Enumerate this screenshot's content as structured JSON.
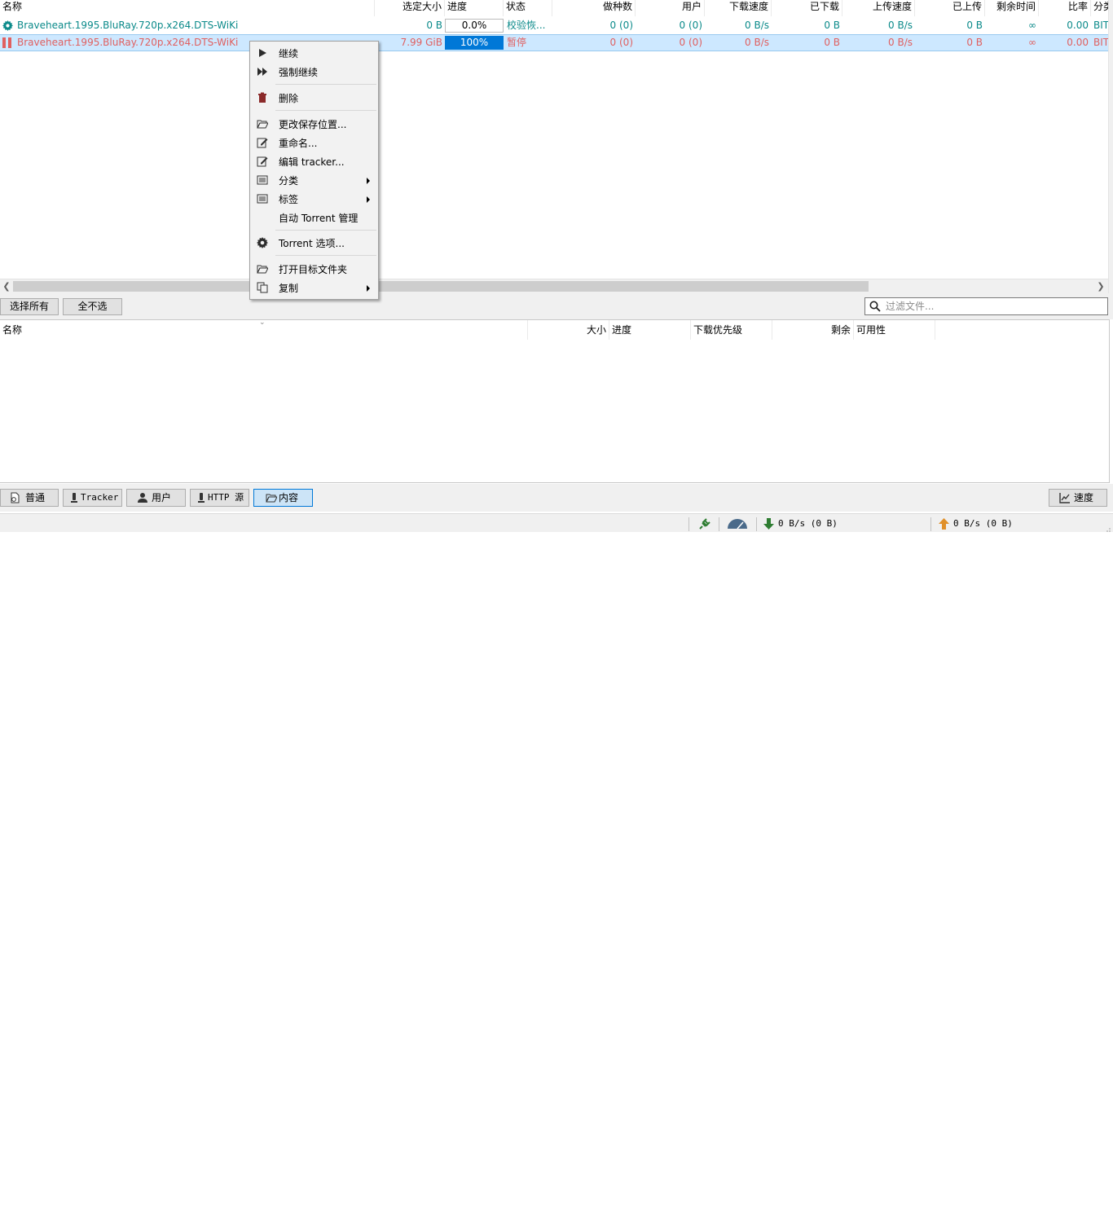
{
  "torrent_table": {
    "columns": [
      "名称",
      "选定大小",
      "进度",
      "状态",
      "做种数",
      "用户",
      "下载速度",
      "已下载",
      "上传速度",
      "已上传",
      "剩余时间",
      "比率",
      "分类"
    ],
    "rows": [
      {
        "name": "Braveheart.1995.BluRay.720p.x264.DTS-WiKi",
        "size": "0 B",
        "progress": "0.0%",
        "progress_fraction": 0.0,
        "status": "校验恢...",
        "seeds": "0 (0)",
        "peers": "0 (0)",
        "dl_speed": "0 B/s",
        "downloaded": "0 B",
        "ul_speed": "0 B/s",
        "uploaded": "0 B",
        "eta": "∞",
        "ratio": "0.00",
        "category": "BIT",
        "icon": "gear-icon",
        "color": "#0b8a8a"
      },
      {
        "name": "Braveheart.1995.BluRay.720p.x264.DTS-WiKi",
        "size": "7.99 GiB",
        "progress": "100%",
        "progress_fraction": 1.0,
        "status": "暂停",
        "seeds": "0 (0)",
        "peers": "0 (0)",
        "dl_speed": "0 B/s",
        "downloaded": "0 B",
        "ul_speed": "0 B/s",
        "uploaded": "0 B",
        "eta": "∞",
        "ratio": "0.00",
        "category": "BIT",
        "icon": "pause-icon",
        "color": "#e06060",
        "selected": true
      }
    ]
  },
  "context_menu": {
    "items": [
      {
        "label": "继续",
        "icon": "play-icon"
      },
      {
        "label": "强制继续",
        "icon": "fast-forward-icon"
      },
      {
        "label": "删除",
        "icon": "trash-icon"
      },
      {
        "label": "更改保存位置...",
        "icon": "folder-open-icon"
      },
      {
        "label": "重命名...",
        "icon": "edit-icon"
      },
      {
        "label": "编辑 tracker...",
        "icon": "edit-icon"
      },
      {
        "label": "分类",
        "icon": "list-icon",
        "submenu": true
      },
      {
        "label": "标签",
        "icon": "list-icon",
        "submenu": true
      },
      {
        "label": "自动 Torrent 管理"
      },
      {
        "label": "Torrent 选项...",
        "icon": "gear-icon"
      },
      {
        "label": "打开目标文件夹",
        "icon": "folder-open-icon"
      },
      {
        "label": "复制",
        "icon": "copy-icon",
        "submenu": true
      }
    ]
  },
  "content_panel": {
    "select_all": "选择所有",
    "select_none": "全不选",
    "filter_placeholder": "过滤文件...",
    "columns": [
      "名称",
      "大小",
      "进度",
      "下载优先级",
      "剩余",
      "可用性"
    ]
  },
  "tabs": [
    {
      "label": "普通",
      "icon": "info-icon"
    },
    {
      "label": "Tracker",
      "icon": "tracker-icon"
    },
    {
      "label": "用户",
      "icon": "users-icon"
    },
    {
      "label": "HTTP 源",
      "icon": "server-icon"
    },
    {
      "label": "内容",
      "icon": "folder-open-icon",
      "active": true
    },
    {
      "label": "速度",
      "icon": "chart-icon"
    }
  ],
  "status_bar": {
    "download": "0 B/s (0 B)",
    "upload": "0 B/s (0 B)"
  },
  "colors": {
    "accent": "#0078d7",
    "checking": "#0b8a8a",
    "paused": "#e06060",
    "selection": "#cde8ff"
  }
}
